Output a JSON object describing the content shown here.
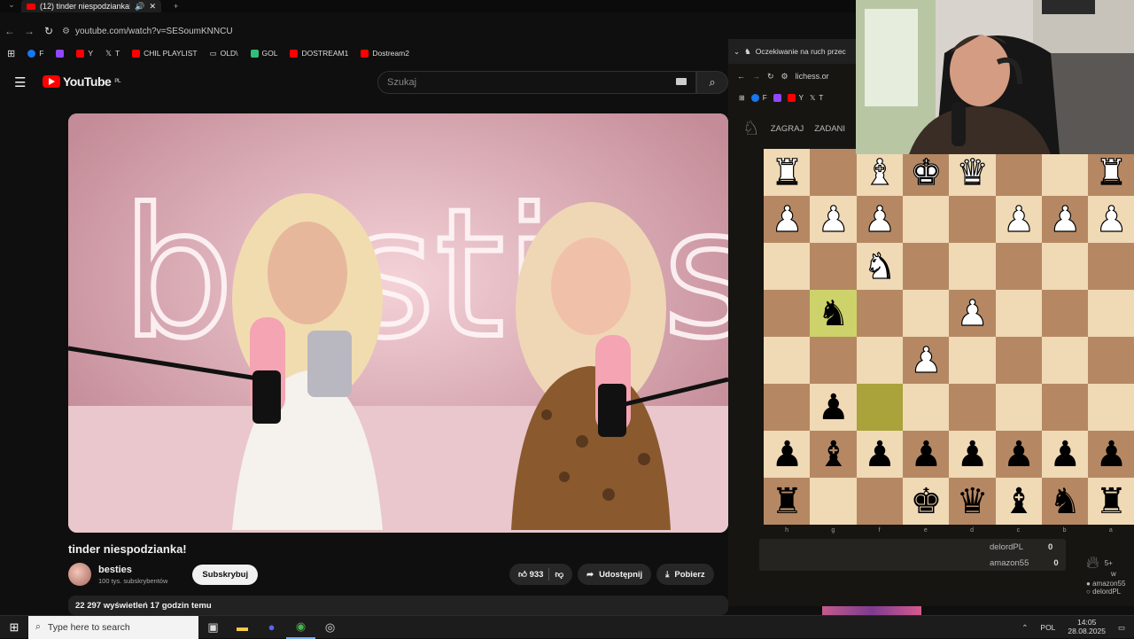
{
  "left_browser": {
    "tab_title": "(12) tinder niespodzianka! -",
    "url": "youtube.com/watch?v=SESoumKNNCU",
    "bookmarks": [
      "F",
      "Y",
      "T",
      "CHIL PLAYLIST",
      "OLD\\",
      "GOL",
      "DOSTREAM1",
      "Dostream2"
    ]
  },
  "youtube": {
    "logo": "YouTube",
    "region": "PL",
    "search_placeholder": "Szukaj",
    "video_title": "tinder niespodzianka!",
    "channel_name": "besties",
    "channel_subs": "100 tys. subskrybentów",
    "subscribe_label": "Subskrybuj",
    "likes": "933",
    "share_label": "Udostępnij",
    "download_label": "Pobierz",
    "views_line": "22 297 wyświetleń  17 godzin temu",
    "video_neon_text": "besties"
  },
  "lichess_window": {
    "tab_title": "Oczekiwanie na ruch przec",
    "url": "lichess.or",
    "bookmarks": [
      "F",
      "Y",
      "T"
    ],
    "nav": [
      "ZAGRAJ",
      "ZADANI"
    ],
    "files": [
      "h",
      "g",
      "f",
      "e",
      "d",
      "c",
      "b",
      "a"
    ],
    "board_rows": [
      [
        "♜",
        "",
        "♝",
        "♚",
        "♛",
        "",
        "",
        "♜"
      ],
      [
        "♟",
        "♟",
        "♟",
        "",
        "",
        "♟",
        "♟",
        "♟"
      ],
      [
        "",
        "",
        "♞",
        "",
        "",
        "",
        "",
        ""
      ],
      [
        "",
        "♞",
        "",
        "",
        "♟",
        "",
        "",
        ""
      ],
      [
        "",
        "",
        "",
        "♟",
        "",
        "",
        "",
        ""
      ],
      [
        "",
        "♟",
        "",
        "",
        "",
        "",
        "",
        ""
      ],
      [
        "♟",
        "♝",
        "♟",
        "♟",
        "♟",
        "♟",
        "♟",
        "♟"
      ],
      [
        "♜",
        "",
        "",
        "♚",
        "♛",
        "♝",
        "♞",
        "♜"
      ]
    ],
    "board_colors": [
      [
        "w",
        "w",
        "w",
        "w",
        "w",
        "w",
        "w",
        "w"
      ],
      [
        "w",
        "w",
        "w",
        "w",
        "w",
        "w",
        "w",
        "w"
      ],
      [
        "w",
        "w",
        "w",
        "w",
        "w",
        "w",
        "w",
        "w"
      ],
      [
        "w",
        "b",
        "w",
        "w",
        "w",
        "w",
        "w",
        "w"
      ],
      [
        "w",
        "w",
        "w",
        "w",
        "w",
        "w",
        "w",
        "w"
      ],
      [
        "w",
        "b",
        "w",
        "w",
        "w",
        "w",
        "w",
        "w"
      ],
      [
        "b",
        "b",
        "b",
        "b",
        "b",
        "b",
        "b",
        "b"
      ],
      [
        "b",
        "b",
        "b",
        "b",
        "b",
        "b",
        "b",
        "b"
      ]
    ],
    "players": [
      {
        "name": "delordPL",
        "score": "0"
      },
      {
        "name": "amazon55",
        "score": "0"
      }
    ],
    "side_players": [
      "amazon55",
      "delordPL"
    ],
    "side_counter": "5+",
    "side_counter_sub": "w",
    "highlight_color": "#cdd26a",
    "highlight_dark_color": "#aaa23a",
    "light_square": "#f0d9b5",
    "dark_square": "#b58863"
  },
  "taskbar": {
    "search_placeholder": "Type here to search",
    "language": "POL",
    "time": "14:05",
    "date": "28.08.2025"
  }
}
